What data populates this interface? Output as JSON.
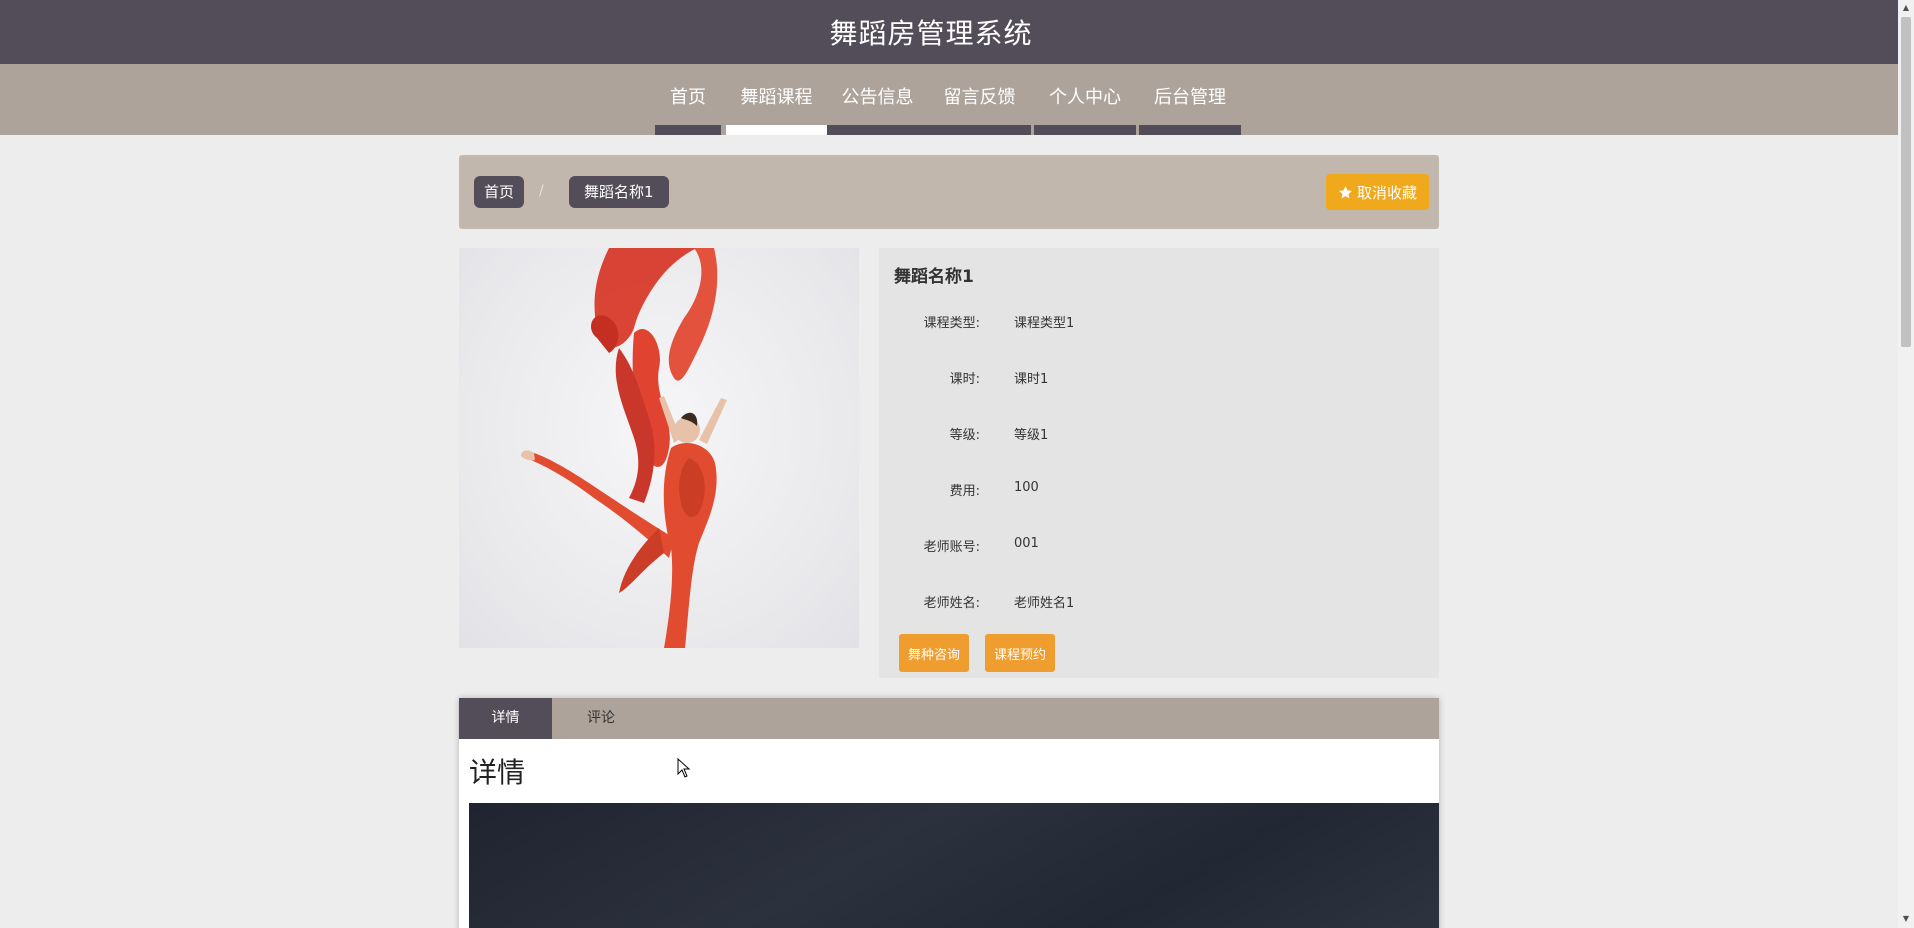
{
  "header": {
    "title": "舞蹈房管理系统"
  },
  "nav": {
    "items": [
      {
        "label": "首页",
        "active": false
      },
      {
        "label": "舞蹈课程",
        "active": true
      },
      {
        "label": "公告信息",
        "active": false
      },
      {
        "label": "留言反馈",
        "active": false
      },
      {
        "label": "个人中心",
        "active": false
      },
      {
        "label": "后台管理",
        "active": false
      }
    ]
  },
  "breadcrumb": {
    "home": "首页",
    "separator": "/",
    "current": "舞蹈名称1"
  },
  "favorite_button": {
    "label": "取消收藏",
    "icon": "star-icon"
  },
  "course": {
    "name": "舞蹈名称1",
    "fields": [
      {
        "label": "课程类型:",
        "value": "课程类型1"
      },
      {
        "label": "课时:",
        "value": "课时1"
      },
      {
        "label": "等级:",
        "value": "等级1"
      },
      {
        "label": "费用:",
        "value": "100"
      },
      {
        "label": "老师账号:",
        "value": "001"
      },
      {
        "label": "老师姓名:",
        "value": "老师姓名1"
      }
    ],
    "buttons": {
      "consult": "舞种咨询",
      "reserve": "课程预约"
    }
  },
  "tabs": {
    "items": [
      {
        "label": "详情",
        "active": true
      },
      {
        "label": "评论",
        "active": false
      }
    ],
    "detail_heading": "详情"
  },
  "colors": {
    "header_bg": "#524d58",
    "nav_bg": "#aea39a",
    "breadcrumb_bg": "#c2b7ad",
    "favorite_button": "#f0a81c",
    "action_button": "#ee9d2e"
  }
}
